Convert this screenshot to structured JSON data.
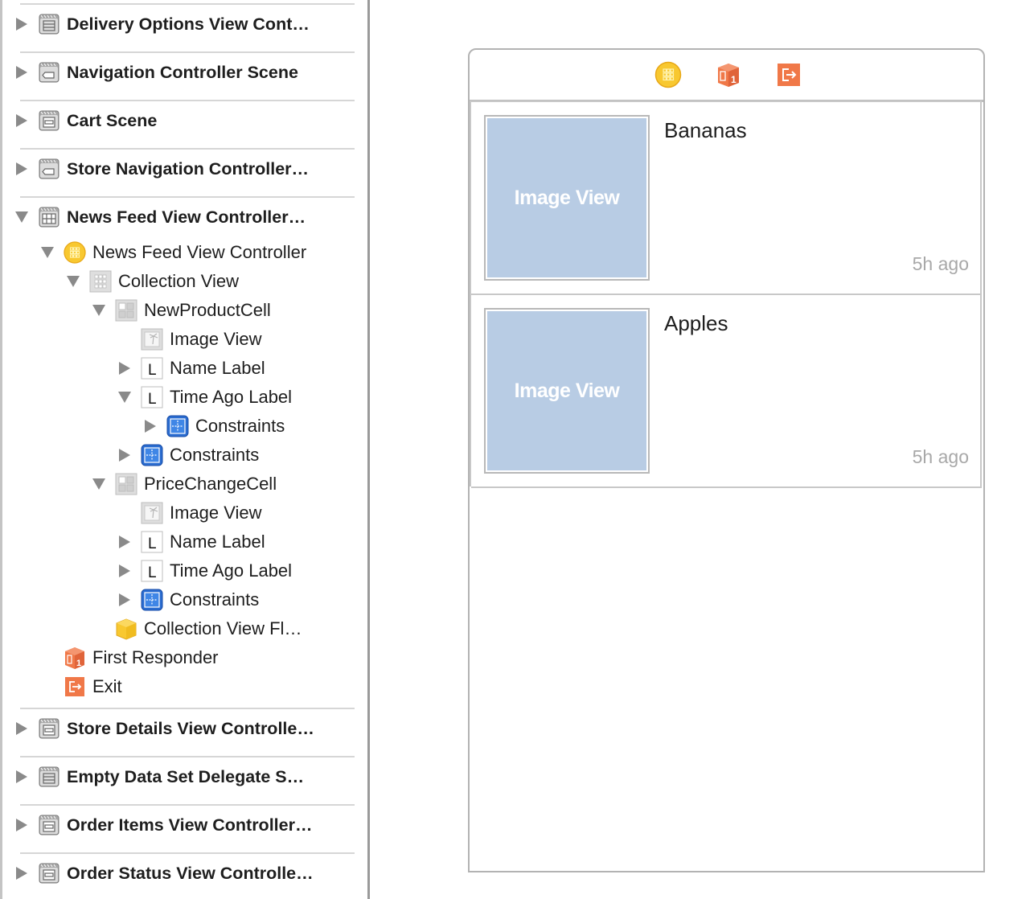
{
  "outline": {
    "scenes_top": [
      {
        "label": "Delivery Options View Cont…",
        "icon": "table-view-controller-icon",
        "expanded": false
      },
      {
        "label": "Navigation Controller Scene",
        "icon": "navigation-controller-icon",
        "expanded": false
      },
      {
        "label": "Cart Scene",
        "icon": "view-controller-icon",
        "expanded": false
      },
      {
        "label": "Store Navigation Controller…",
        "icon": "navigation-controller-icon",
        "expanded": false
      },
      {
        "label": "News Feed View Controller…",
        "icon": "collection-view-controller-scene-icon",
        "expanded": true
      }
    ],
    "tree": [
      {
        "label": "News Feed View Controller",
        "icon": "view-controller-circle-icon",
        "depth": 0,
        "disclosure": "down"
      },
      {
        "label": "Collection View",
        "icon": "collection-view-icon",
        "depth": 1,
        "disclosure": "down"
      },
      {
        "label": "NewProductCell",
        "icon": "collection-cell-icon",
        "depth": 2,
        "disclosure": "down"
      },
      {
        "label": "Image View",
        "icon": "image-view-icon",
        "depth": 3,
        "disclosure": "none"
      },
      {
        "label": "Name Label",
        "icon": "label-icon",
        "depth": 3,
        "disclosure": "right"
      },
      {
        "label": "Time Ago Label",
        "icon": "label-icon",
        "depth": 3,
        "disclosure": "down"
      },
      {
        "label": "Constraints",
        "icon": "constraints-icon",
        "depth": 4,
        "disclosure": "right"
      },
      {
        "label": "Constraints",
        "icon": "constraints-icon",
        "depth": 3,
        "disclosure": "right"
      },
      {
        "label": "PriceChangeCell",
        "icon": "collection-cell-icon",
        "depth": 2,
        "disclosure": "down"
      },
      {
        "label": "Image View",
        "icon": "image-view-icon",
        "depth": 3,
        "disclosure": "none"
      },
      {
        "label": "Name Label",
        "icon": "label-icon",
        "depth": 3,
        "disclosure": "right"
      },
      {
        "label": "Time Ago Label",
        "icon": "label-icon",
        "depth": 3,
        "disclosure": "right"
      },
      {
        "label": "Constraints",
        "icon": "constraints-icon",
        "depth": 3,
        "disclosure": "right"
      },
      {
        "label": "Collection View Fl…",
        "icon": "flow-layout-cube-icon",
        "depth": 2,
        "disclosure": "none"
      },
      {
        "label": "First Responder",
        "icon": "first-responder-icon",
        "depth": 0,
        "disclosure": "none"
      },
      {
        "label": "Exit",
        "icon": "exit-icon",
        "depth": 0,
        "disclosure": "none"
      }
    ],
    "scenes_bottom": [
      {
        "label": "Store Details View Controlle…",
        "icon": "view-controller-icon",
        "expanded": false
      },
      {
        "label": "Empty Data Set Delegate S…",
        "icon": "table-view-controller-icon",
        "expanded": false
      },
      {
        "label": "Order Items View Controller…",
        "icon": "view-controller-icon",
        "expanded": false
      },
      {
        "label": "Order Status View Controlle…",
        "icon": "view-controller-icon",
        "expanded": false
      }
    ]
  },
  "canvas": {
    "dock_icons": [
      "view-controller-circle-icon",
      "first-responder-icon",
      "exit-icon"
    ],
    "cells": [
      {
        "image_placeholder": "Image View",
        "name": "Bananas",
        "time_ago": "5h ago"
      },
      {
        "image_placeholder": "Image View",
        "name": "Apples",
        "time_ago": "5h ago"
      }
    ]
  },
  "colors": {
    "image_view_fill": "#b8cce4",
    "yellow_icon": "#f8c830",
    "orange_icon": "#f07848",
    "constraints_blue": "#2a6cd0",
    "time_ago_gray": "#a8a8a8"
  }
}
